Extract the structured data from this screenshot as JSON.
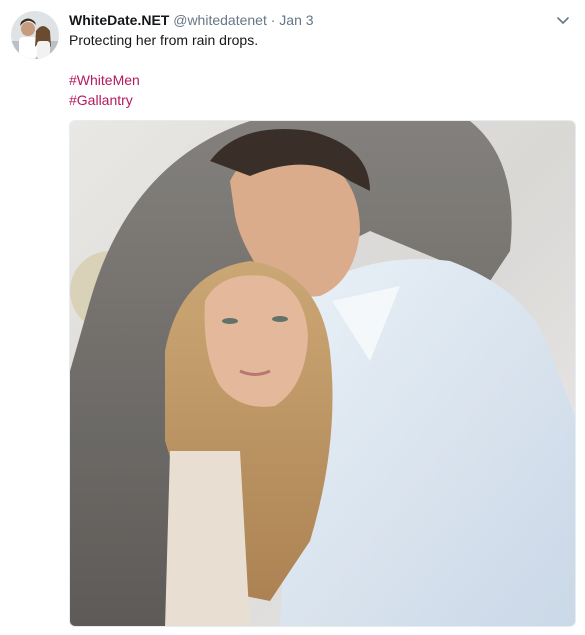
{
  "tweet": {
    "display_name": "WhiteDate.NET",
    "handle": "@whitedatenet",
    "separator": "·",
    "timestamp": "Jan 3",
    "text": "Protecting her from rain drops.",
    "hashtags": [
      "#WhiteMen",
      "#Gallantry"
    ],
    "avatar_icon": "profile-avatar",
    "menu_icon": "chevron-down-icon",
    "media_alt": "photo"
  },
  "colors": {
    "hashtag": "#b41a5d",
    "muted": "#657786",
    "text": "#14171a"
  }
}
